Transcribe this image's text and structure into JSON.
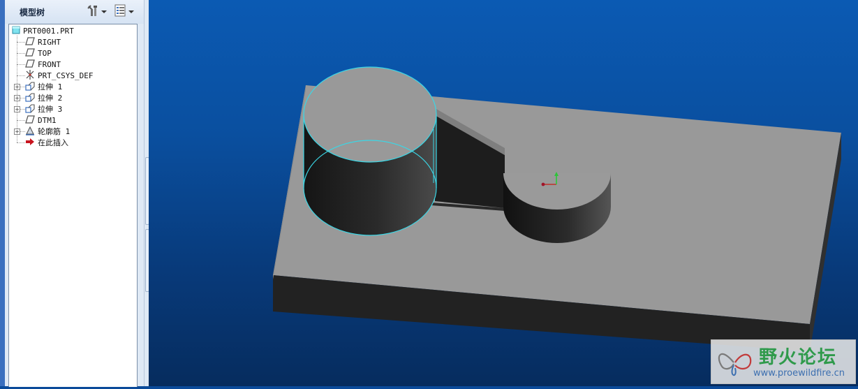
{
  "model_tree": {
    "title": "模型树",
    "settings_button": "settings-icon",
    "show_button": "show-list-icon",
    "root": "PRT0001.PRT",
    "items": [
      {
        "label": "RIGHT",
        "icon": "datum-plane-icon",
        "expandable": false
      },
      {
        "label": "TOP",
        "icon": "datum-plane-icon",
        "expandable": false
      },
      {
        "label": "FRONT",
        "icon": "datum-plane-icon",
        "expandable": false
      },
      {
        "label": "PRT_CSYS_DEF",
        "icon": "csys-icon",
        "expandable": false
      },
      {
        "label": "拉伸 1",
        "icon": "extrude-icon",
        "expandable": true
      },
      {
        "label": "拉伸 2",
        "icon": "extrude-icon",
        "expandable": true
      },
      {
        "label": "拉伸 3",
        "icon": "extrude-icon",
        "expandable": true
      },
      {
        "label": "DTM1",
        "icon": "datum-plane-icon",
        "expandable": false
      },
      {
        "label": "轮廓筋 1",
        "icon": "rib-icon",
        "expandable": true
      },
      {
        "label": "在此插入",
        "icon": "insert-here-arrow-icon",
        "expandable": false
      }
    ]
  },
  "watermark": {
    "title": "野火论坛",
    "url": "www.proewildfire.cn"
  },
  "colors": {
    "viewport_top": "#0b5ab3",
    "viewport_bottom": "#062c5e",
    "model_top": "#999999",
    "model_side": "#1f1f1f",
    "highlight": "#3ad7e6",
    "watermark_green": "#2f9a4b"
  }
}
